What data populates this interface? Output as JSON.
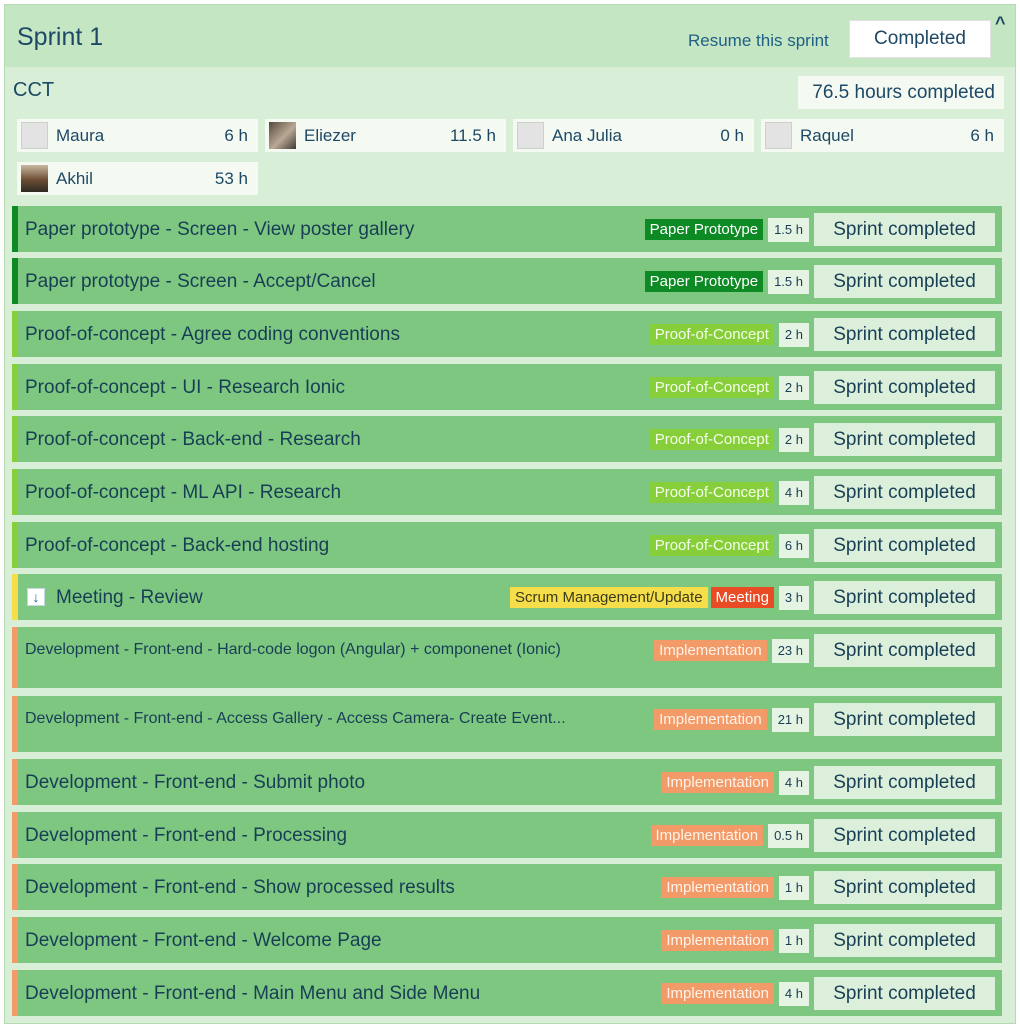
{
  "header": {
    "title": "Sprint 1",
    "resume_label": "Resume this sprint",
    "completed_label": "Completed",
    "collapse_icon": "chevron-up-icon"
  },
  "team": {
    "name": "CCT",
    "hours_total": "76.5 hours completed"
  },
  "members": [
    {
      "name": "Maura",
      "hours": "6 h",
      "avatar": "blank"
    },
    {
      "name": "Eliezer",
      "hours": "11.5 h",
      "avatar": "photo"
    },
    {
      "name": "Ana Julia",
      "hours": "0 h",
      "avatar": "blank"
    },
    {
      "name": "Raquel",
      "hours": "6 h",
      "avatar": "blank"
    },
    {
      "name": "Akhil",
      "hours": "53 h",
      "avatar": "photo"
    }
  ],
  "tasks": [
    {
      "title": "Paper prototype - Screen - View poster gallery",
      "tags": [
        "Paper Prototype"
      ],
      "hours": "1.5 h",
      "status": "Sprint completed"
    },
    {
      "title": "Paper prototype - Screen - Accept/Cancel",
      "tags": [
        "Paper Prototype"
      ],
      "hours": "1.5 h",
      "status": "Sprint completed"
    },
    {
      "title": "Proof-of-concept - Agree coding conventions",
      "tags": [
        "Proof-of-Concept"
      ],
      "hours": "2 h",
      "status": "Sprint completed"
    },
    {
      "title": "Proof-of-concept - UI - Research Ionic",
      "tags": [
        "Proof-of-Concept"
      ],
      "hours": "2 h",
      "status": "Sprint completed"
    },
    {
      "title": "Proof-of-concept - Back-end - Research",
      "tags": [
        "Proof-of-Concept"
      ],
      "hours": "2 h",
      "status": "Sprint completed"
    },
    {
      "title": "Proof-of-concept - ML API - Research",
      "tags": [
        "Proof-of-Concept"
      ],
      "hours": "4 h",
      "status": "Sprint completed"
    },
    {
      "title": "Proof-of-concept - Back-end hosting",
      "tags": [
        "Proof-of-Concept"
      ],
      "hours": "6 h",
      "status": "Sprint completed"
    },
    {
      "title": "Meeting - Review",
      "tags": [
        "Scrum Management/Update",
        "Meeting"
      ],
      "hours": "3 h",
      "status": "Sprint completed"
    },
    {
      "title": "Development - Front-end - Hard-code logon (Angular) + componenet (Ionic)",
      "tags": [
        "Implementation"
      ],
      "hours": "23 h",
      "status": "Sprint completed"
    },
    {
      "title": "Development - Front-end - Access Gallery - Access Camera- Create Event...",
      "tags": [
        "Implementation"
      ],
      "hours": "21 h",
      "status": "Sprint completed"
    },
    {
      "title": "Development - Front-end - Submit photo",
      "tags": [
        "Implementation"
      ],
      "hours": "4 h",
      "status": "Sprint completed"
    },
    {
      "title": "Development - Front-end - Processing",
      "tags": [
        "Implementation"
      ],
      "hours": "0.5 h",
      "status": "Sprint completed"
    },
    {
      "title": "Development - Front-end - Show processed results",
      "tags": [
        "Implementation"
      ],
      "hours": "1 h",
      "status": "Sprint completed"
    },
    {
      "title": "Development - Front-end - Welcome Page",
      "tags": [
        "Implementation"
      ],
      "hours": "1 h",
      "status": "Sprint completed"
    },
    {
      "title": "Development - Front-end - Main Menu and Side Menu",
      "tags": [
        "Implementation"
      ],
      "hours": "4 h",
      "status": "Sprint completed"
    }
  ],
  "colors": {
    "paper_prototype": "#0e8a25",
    "proof_of_concept": "#86cf3a",
    "meeting_bar": "#f6de4b",
    "implementation": "#f29a68",
    "task_background": "#7ec780"
  }
}
